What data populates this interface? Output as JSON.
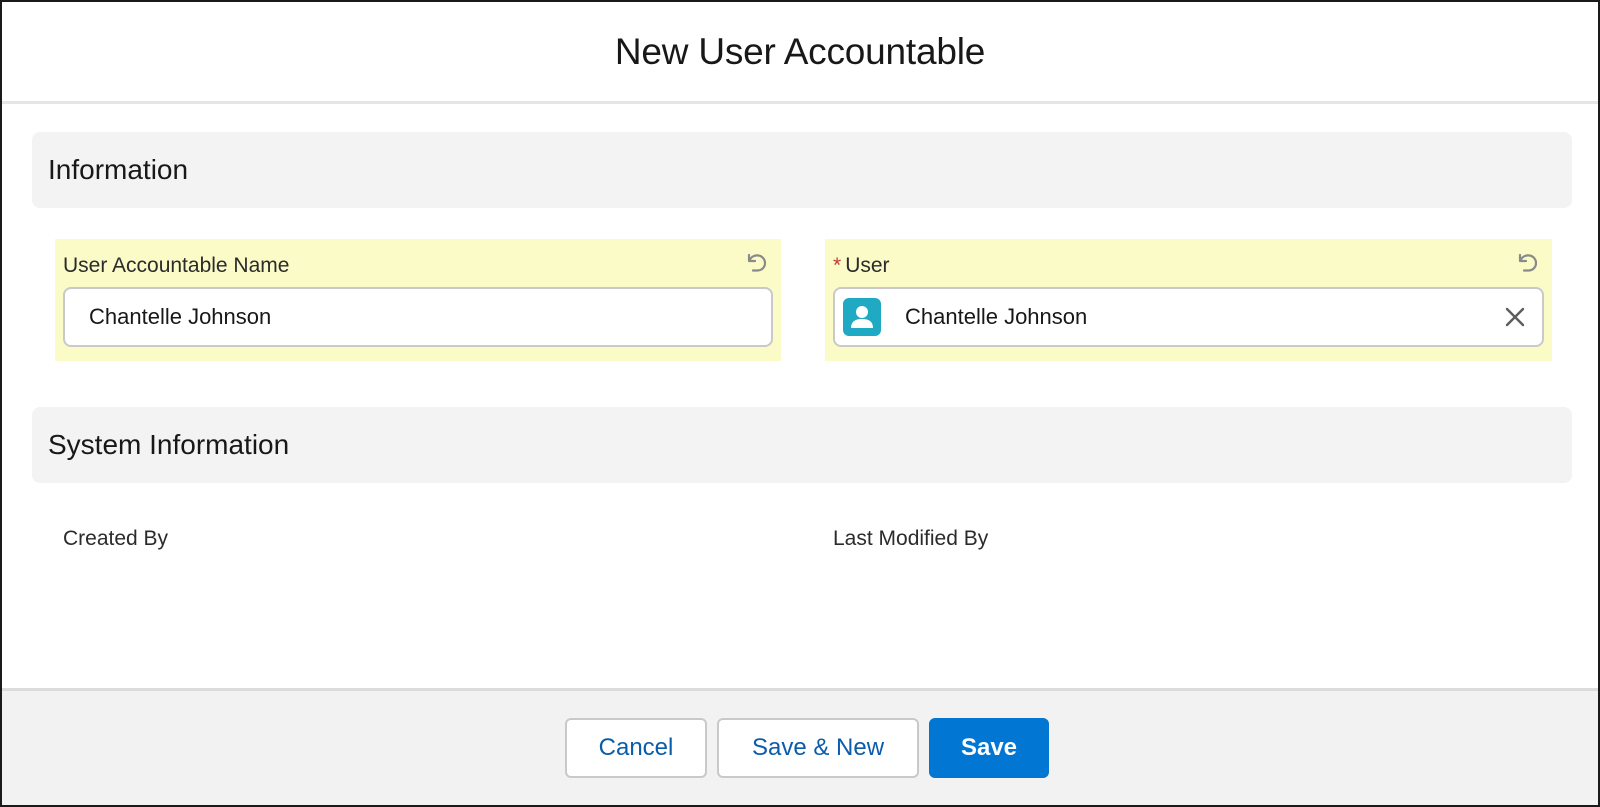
{
  "modal": {
    "title": "New User Accountable"
  },
  "sections": {
    "information": "Information",
    "system_information": "System Information"
  },
  "fields": {
    "user_accountable_name": {
      "label": "User Accountable Name",
      "value": "Chantelle Johnson",
      "icon": "undo-icon"
    },
    "user": {
      "required_marker": "*",
      "label": "User",
      "value": "Chantelle Johnson",
      "icon": "user-icon",
      "clear_icon": "close-icon",
      "undo_icon": "undo-icon"
    }
  },
  "system_fields": {
    "created_by": "Created By",
    "last_modified_by": "Last Modified By"
  },
  "footer": {
    "cancel_label": "Cancel",
    "save_new_label": "Save & New",
    "save_label": "Save"
  },
  "colors": {
    "brand": "#0176d3",
    "changed_field_highlight": "#fbfbc8",
    "required": "#c23934",
    "user_icon_bg": "#1fa9c2"
  }
}
